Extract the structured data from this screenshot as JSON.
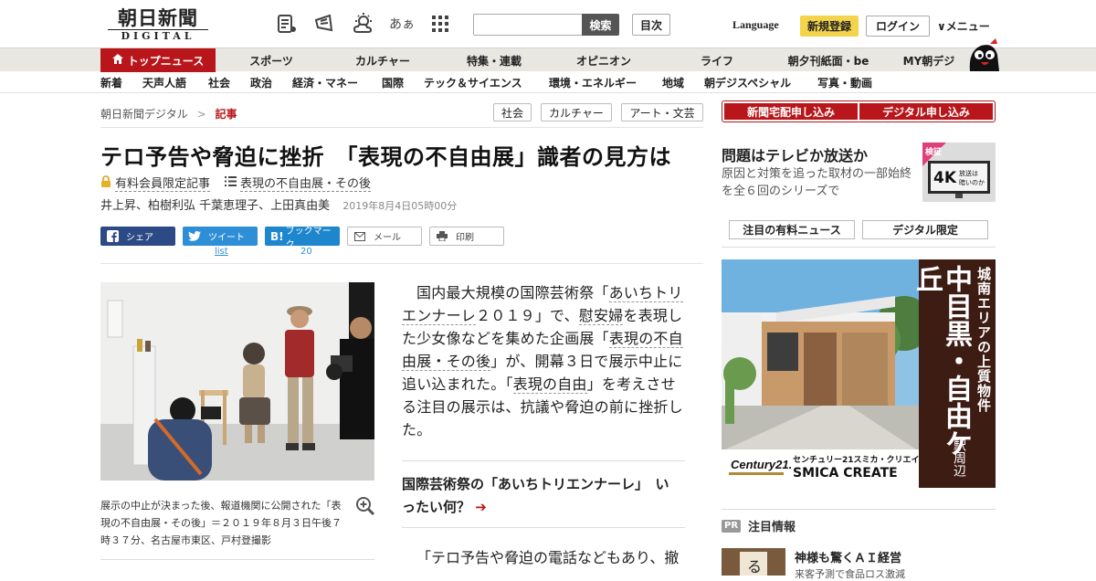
{
  "header": {
    "logo_main": "朝日新聞",
    "logo_sub": "DIGITAL",
    "icons": [
      "newspaper-icon",
      "megaphone-icon",
      "weather-icon",
      "font-size-icon",
      "grid-icon"
    ],
    "font_size_label": "あぁ",
    "search_button": "検索",
    "toc_button": "目次",
    "language": "Language",
    "register": "新規登録",
    "login": "ログイン",
    "menu": "メニュー"
  },
  "global_nav": [
    "トップニュース",
    "スポーツ",
    "カルチャー",
    "特集・連載",
    "オピニオン",
    "ライフ",
    "朝夕刊紙面・be",
    "MY朝デジ"
  ],
  "sub_nav": [
    "新着",
    "天声人語",
    "社会",
    "政治",
    "経済・マネー",
    "国際",
    "テック＆サイエンス",
    "環境・エネルギー",
    "地域",
    "朝デジスペシャル",
    "写真・動画"
  ],
  "breadcrumb": {
    "home": "朝日新聞デジタル",
    "sep": ">",
    "current": "記事"
  },
  "tags": [
    "社会",
    "カルチャー",
    "アート・文芸"
  ],
  "article": {
    "headline": "テロ予告や脅迫に挫折　「表現の不自由展」識者の見方は",
    "membership": "有料会員限定記事",
    "series": "表現の不自由展・その後",
    "authors": "井上昇、柏樹利弘 千葉恵理子、上田真由美",
    "date": "2019年8月4日05時00分",
    "share": {
      "facebook": "シェア",
      "twitter": "ツイート",
      "twitter_count": "list",
      "hatena": "ブックマーク",
      "hatena_count": "20",
      "mail": "メール",
      "print": "印刷"
    },
    "caption": "展示の中止が決まった後、報道機関に公開された「表現の不自由展・その後」＝２０１９年８月３日午後７時３７分、名古屋市東区、戸村登撮影",
    "body": {
      "p1_a": "国内最大規模の国際芸術祭「",
      "p1_link1": "あいちトリエンナーレ",
      "p1_b": "２０１９」で、",
      "p1_link2": "慰安婦",
      "p1_c": "を表現した少女像などを集めた企画展「",
      "p1_link3": "表現の不自由展・その後",
      "p1_d": "」が、開幕３日で展示中止に追い込まれた。「",
      "p1_link4": "表現の自由",
      "p1_e": "」を考えさせる注目の展示は、抗議や脅迫の前に挫折した。"
    },
    "related": "国際芸術祭の「あいちトリエンナーレ」　いったい何？",
    "related_arrow": "➔",
    "p2": "「テロ予告や脅迫の電話などもあり、撤"
  },
  "sidebar": {
    "subscribe_newspaper": "新聞宅配申し込み",
    "subscribe_digital": "デジタル申し込み",
    "promo_title": "問題はテレビか放送か",
    "promo_desc": "原因と対策を追った取材の一部始終を全６回のシリーズで",
    "promo_img_text1": "検証",
    "promo_img_text2": "4K",
    "promo_img_text3": "放送は",
    "promo_img_text4": "暗いのか",
    "paid_news": "注目の有料ニュース",
    "digital_only": "デジタル限定",
    "ad": {
      "line1": "城南エリアの上質物件",
      "big": "中目黒・自由ケ丘",
      "station": "駅周辺",
      "brand_small": "センチュリー21スミカ・クリエイト",
      "brand_big": "SMICA CREATE",
      "century": "Century21."
    },
    "pr_badge": "PR",
    "pr_heading": "注目情報",
    "pr_title": "神様も驚くＡＩ経営",
    "pr_sub": "来客予測で食品ロス激減"
  },
  "colors": {
    "brand_red": "#b8161a",
    "register_yellow": "#f3d44b",
    "facebook": "#2c4a86",
    "twitter": "#2e8fd6",
    "hatena": "#1e86cc"
  }
}
